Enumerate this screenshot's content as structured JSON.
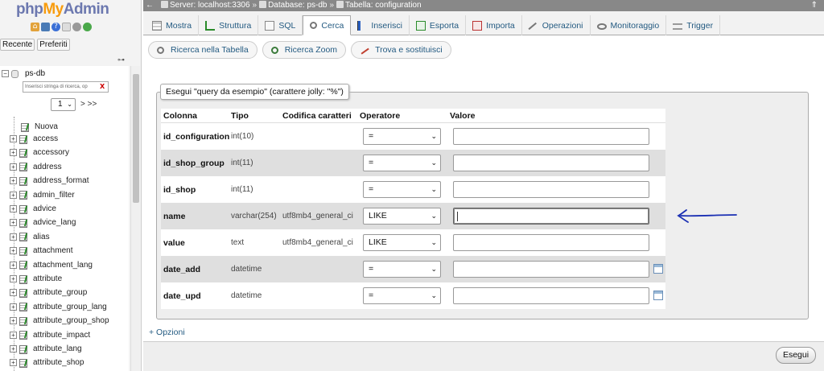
{
  "logo": {
    "php": "php",
    "my": "My",
    "admin": "Admin"
  },
  "nav": {
    "tabs": [
      "Recente",
      "Preferiti"
    ],
    "database": "ps-db",
    "filter_placeholder": "Inserisci stringa di ricerca, op",
    "filter_clear": "X",
    "page_value": "1",
    "page_next": "> >>",
    "new_label": "Nuova",
    "tables": [
      "access",
      "accessory",
      "address",
      "address_format",
      "admin_filter",
      "advice",
      "advice_lang",
      "alias",
      "attachment",
      "attachment_lang",
      "attribute",
      "attribute_group",
      "attribute_group_lang",
      "attribute_group_shop",
      "attribute_impact",
      "attribute_lang",
      "attribute_shop"
    ]
  },
  "topbar": {
    "server": "Server: localhost:3306",
    "database": "Database: ps-db",
    "table": "Tabella: configuration",
    "separator": "»"
  },
  "tabs": [
    {
      "label": "Mostra",
      "icon": "browse-icon"
    },
    {
      "label": "Struttura",
      "icon": "structure-icon"
    },
    {
      "label": "SQL",
      "icon": "sql-icon"
    },
    {
      "label": "Cerca",
      "icon": "search-icon",
      "active": true
    },
    {
      "label": "Inserisci",
      "icon": "insert-icon"
    },
    {
      "label": "Esporta",
      "icon": "export-icon"
    },
    {
      "label": "Importa",
      "icon": "import-icon"
    },
    {
      "label": "Operazioni",
      "icon": "wrench-icon"
    },
    {
      "label": "Monitoraggio",
      "icon": "eye-icon"
    },
    {
      "label": "Trigger",
      "icon": "trigger-icon"
    }
  ],
  "subtabs": [
    {
      "label": "Ricerca nella Tabella",
      "icon": "search-icon"
    },
    {
      "label": "Ricerca Zoom",
      "icon": "zoom-icon"
    },
    {
      "label": "Trova e sostituisci",
      "icon": "replace-icon"
    }
  ],
  "form": {
    "legend": "Esegui \"query da esempio\" (carattere jolly: \"%\")",
    "headers": {
      "column": "Colonna",
      "type": "Tipo",
      "collation": "Codifica caratteri",
      "operator": "Operatore",
      "value": "Valore"
    },
    "rows": [
      {
        "name": "id_configuration",
        "type": "int(10)",
        "collation": "",
        "operator": "=",
        "calendar": false
      },
      {
        "name": "id_shop_group",
        "type": "int(11)",
        "collation": "",
        "operator": "=",
        "calendar": false
      },
      {
        "name": "id_shop",
        "type": "int(11)",
        "collation": "",
        "operator": "=",
        "calendar": false
      },
      {
        "name": "name",
        "type": "varchar(254)",
        "collation": "utf8mb4_general_ci",
        "operator": "LIKE",
        "calendar": false,
        "focused": true
      },
      {
        "name": "value",
        "type": "text",
        "collation": "utf8mb4_general_ci",
        "operator": "LIKE",
        "calendar": false
      },
      {
        "name": "date_add",
        "type": "datetime",
        "collation": "",
        "operator": "=",
        "calendar": true
      },
      {
        "name": "date_upd",
        "type": "datetime",
        "collation": "",
        "operator": "=",
        "calendar": true
      }
    ],
    "options_link": "+ Opzioni",
    "submit": "Esegui"
  },
  "colors": {
    "link": "#235a81",
    "topbar": "#888888",
    "annotation": "#1a2fb3"
  }
}
